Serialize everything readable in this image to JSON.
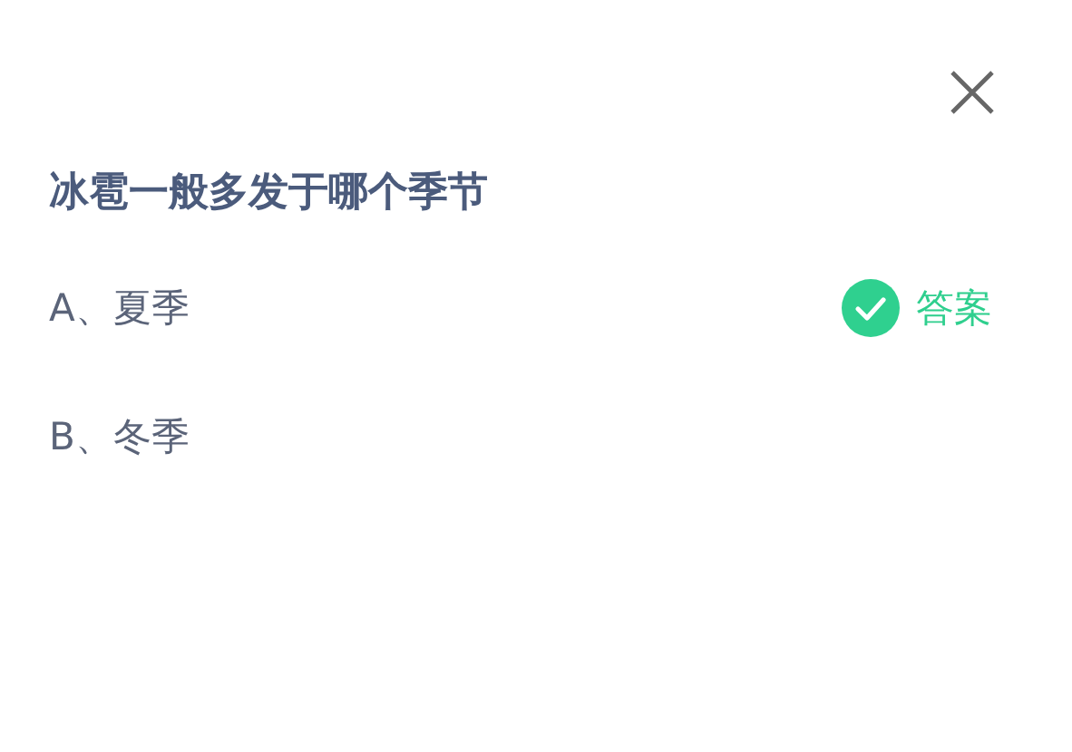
{
  "question": "冰雹一般多发于哪个季节",
  "answer_label": "答案",
  "options": [
    {
      "label": "A、夏季",
      "correct": true
    },
    {
      "label": "B、冬季",
      "correct": false
    }
  ]
}
